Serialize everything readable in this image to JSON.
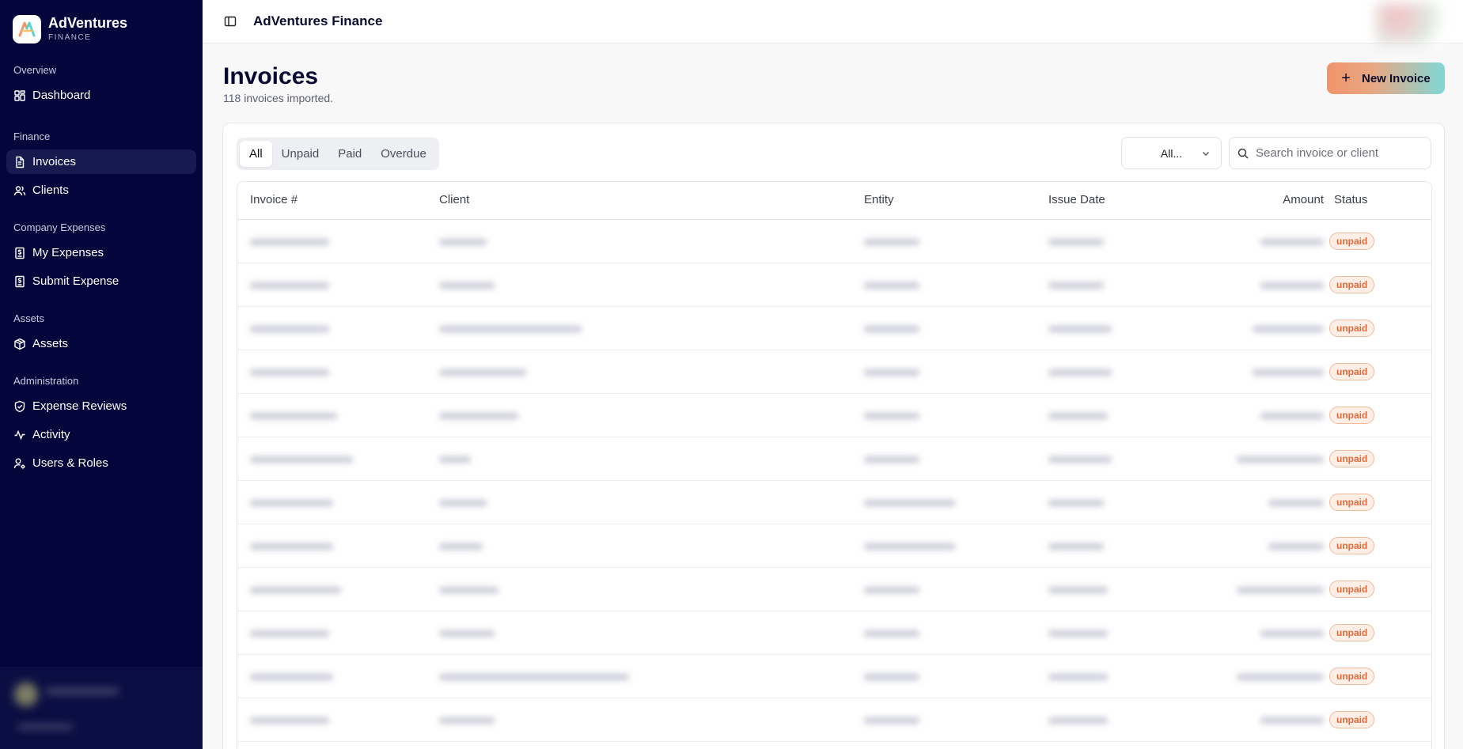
{
  "brand": {
    "name": "AdVentures",
    "sub": "FINANCE"
  },
  "sidebar": {
    "groups": [
      {
        "label": "Overview",
        "items": [
          {
            "label": "Dashboard",
            "icon": "dashboard-icon"
          }
        ]
      },
      {
        "label": "Finance",
        "items": [
          {
            "label": "Invoices",
            "icon": "file-icon",
            "active": true
          },
          {
            "label": "Clients",
            "icon": "users-icon"
          }
        ]
      },
      {
        "label": "Company Expenses",
        "items": [
          {
            "label": "My Expenses",
            "icon": "receipt-icon"
          },
          {
            "label": "Submit Expense",
            "icon": "receipt-icon"
          }
        ]
      },
      {
        "label": "Assets",
        "items": [
          {
            "label": "Assets",
            "icon": "box-icon"
          }
        ]
      },
      {
        "label": "Administration",
        "items": [
          {
            "label": "Expense Reviews",
            "icon": "shield-check-icon"
          },
          {
            "label": "Activity",
            "icon": "activity-icon"
          },
          {
            "label": "Users & Roles",
            "icon": "user-cog-icon"
          }
        ]
      }
    ]
  },
  "topbar": {
    "title": "AdVentures Finance"
  },
  "page": {
    "title": "Invoices",
    "subtitle": "118 invoices imported.",
    "new_button": "New Invoice"
  },
  "filters": {
    "tabs": [
      "All",
      "Unpaid",
      "Paid",
      "Overdue"
    ],
    "active_tab": "All",
    "entity_select": "All...",
    "search_placeholder": "Search invoice or client"
  },
  "table": {
    "columns": [
      "Invoice #",
      "Client",
      "Entity",
      "Issue Date",
      "Amount",
      "Status"
    ],
    "rows": [
      {
        "status": "unpaid"
      },
      {
        "status": "unpaid"
      },
      {
        "status": "unpaid"
      },
      {
        "status": "unpaid"
      },
      {
        "status": "unpaid"
      },
      {
        "status": "unpaid"
      },
      {
        "status": "unpaid"
      },
      {
        "status": "unpaid"
      },
      {
        "status": "unpaid"
      },
      {
        "status": "unpaid"
      },
      {
        "status": "unpaid"
      },
      {
        "status": "unpaid"
      }
    ]
  },
  "colors": {
    "sidebar_bg": "#04053a",
    "accent_orange": "#e06a3b",
    "button_gradient_start": "#f0946a",
    "button_gradient_end": "#7fd8d6"
  }
}
